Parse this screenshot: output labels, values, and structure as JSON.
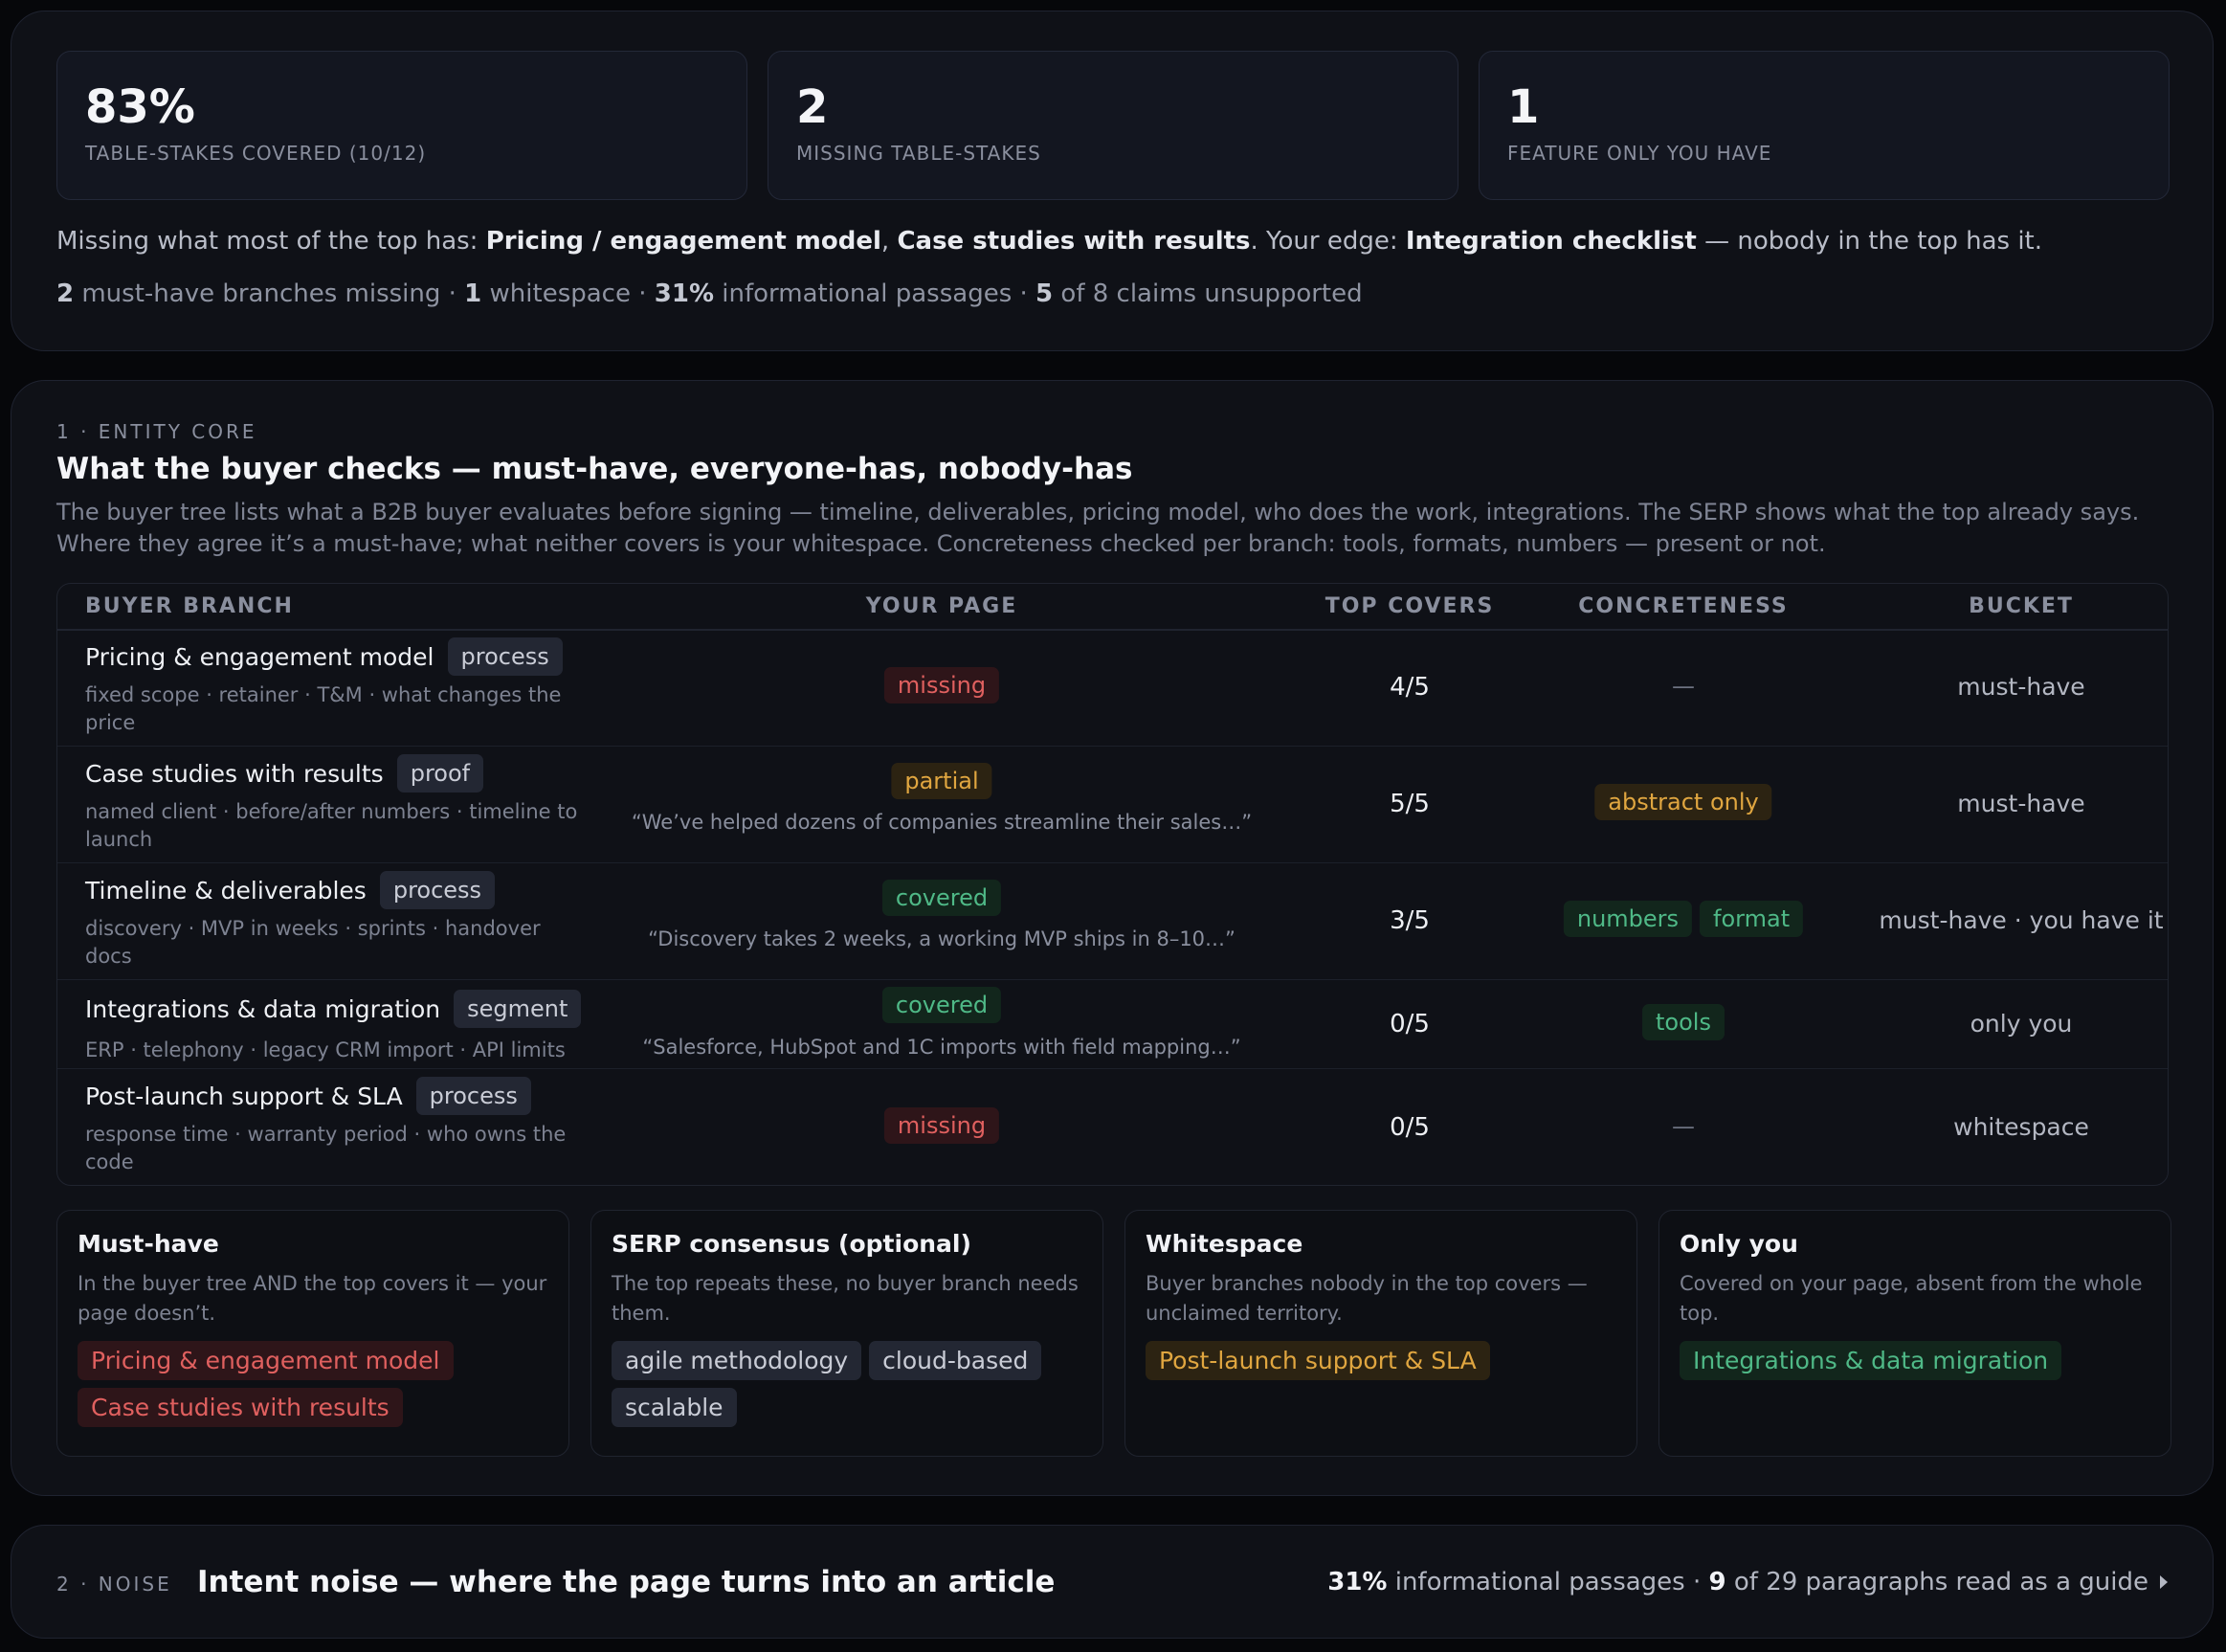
{
  "summary": {
    "stats": [
      {
        "value": "83%",
        "label": "TABLE-STAKES COVERED (10/12)"
      },
      {
        "value": "2",
        "label": "MISSING TABLE-STAKES"
      },
      {
        "value": "1",
        "label": "FEATURE ONLY YOU HAVE"
      }
    ],
    "line1": {
      "prefix": "Missing what most of the top has: ",
      "item1": "Pricing / engagement model",
      "sep": ", ",
      "item2": "Case studies with results",
      "mid": ". Your edge: ",
      "edge": "Integration checklist",
      "suffix": " — nobody in the top has it."
    },
    "line2": {
      "n1": "2",
      "t1": " must-have branches missing · ",
      "n2": "1",
      "t2": " whitespace · ",
      "n3": "31%",
      "t3": " informational passages · ",
      "n4": "5",
      "t4": " of 8 claims unsupported"
    }
  },
  "core": {
    "eyebrow": "1 · ENTITY CORE",
    "title": "What the buyer checks — must-have, everyone-has, nobody-has",
    "description": "The buyer tree lists what a B2B buyer evaluates before signing — timeline, deliverables, pricing model, who does the work, integrations. The SERP shows what the top already says. Where they agree it’s a must-have; what neither covers is your whitespace. Concreteness checked per branch: tools, formats, numbers — present or not.",
    "columns": [
      "BUYER BRANCH",
      "YOUR PAGE",
      "TOP COVERS",
      "CONCRETENESS",
      "BUCKET"
    ],
    "rows": [
      {
        "name": "Pricing & engagement model",
        "tag": "process",
        "sub": "fixed scope · retainer · T&M · what changes the price",
        "status": "missing",
        "quote": "",
        "covers": "4/5",
        "concreteness": [],
        "dash": "—",
        "bucket": "must-have"
      },
      {
        "name": "Case studies with results",
        "tag": "proof",
        "sub": "named client · before/after numbers · timeline to launch",
        "status": "partial",
        "quote": "“We’ve helped dozens of companies streamline their sales…”",
        "covers": "5/5",
        "concreteness": [
          "abstract only"
        ],
        "dash": "",
        "bucket": "must-have"
      },
      {
        "name": "Timeline & deliverables",
        "tag": "process",
        "sub": "discovery · MVP in weeks · sprints · handover docs",
        "status": "covered",
        "quote": "“Discovery takes 2 weeks, a working MVP ships in 8–10…”",
        "covers": "3/5",
        "concreteness": [
          "numbers",
          "format"
        ],
        "dash": "",
        "bucket": "must-have · you have it"
      },
      {
        "name": "Integrations & data migration",
        "tag": "segment",
        "sub": "ERP · telephony · legacy CRM import · API limits",
        "status": "covered",
        "quote": "“Salesforce, HubSpot and 1C imports with field mapping…”",
        "covers": "0/5",
        "concreteness": [
          "tools"
        ],
        "dash": "",
        "bucket": "only you"
      },
      {
        "name": "Post-launch support & SLA",
        "tag": "process",
        "sub": "response time · warranty period · who owns the code",
        "status": "missing",
        "quote": "",
        "covers": "0/5",
        "concreteness": [],
        "dash": "—",
        "bucket": "whitespace"
      }
    ],
    "buckets": [
      {
        "title": "Must-have",
        "desc": "In the buyer tree AND the top covers it — your page doesn’t.",
        "tags": [
          "Pricing & engagement model",
          "Case studies with results"
        ],
        "color": "#e0605f"
      },
      {
        "title": "SERP consensus (optional)",
        "desc": "The top repeats these, no buyer branch needs them.",
        "tags": [
          "agile methodology",
          "cloud-based",
          "scalable"
        ],
        "color": "#c9ccd6"
      },
      {
        "title": "Whitespace",
        "desc": "Buyer branches nobody in the top covers — unclaimed territory.",
        "tags": [
          "Post-launch support & SLA"
        ],
        "color": "#e0a640"
      },
      {
        "title": "Only you",
        "desc": "Covered on your page, absent from the whole top.",
        "tags": [
          "Integrations & data migration"
        ],
        "color": "#4fb987"
      }
    ]
  },
  "noise": {
    "eyebrow": "2 · NOISE",
    "title": "Intent noise — where the page turns into an article",
    "n1": "31%",
    "t1": " informational passages · ",
    "n2": "9",
    "t2": " of 29 paragraphs read as a guide"
  }
}
